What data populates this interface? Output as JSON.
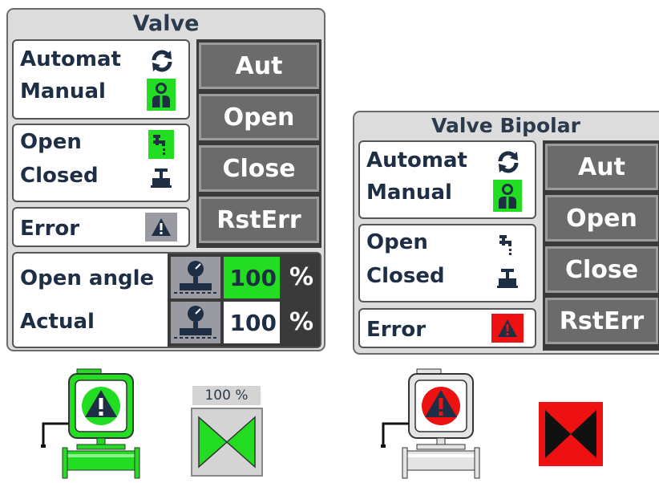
{
  "valve": {
    "title": "Valve",
    "mode_automat": "Automat",
    "mode_manual": "Manual",
    "state_open": "Open",
    "state_closed": "Closed",
    "error": "Error",
    "buttons": {
      "aut": "Aut",
      "open": "Open",
      "close": "Close",
      "rsterr": "RstErr"
    },
    "open_angle_label": "Open angle",
    "open_angle_value": "100",
    "actual_label": "Actual",
    "actual_value": "100",
    "unit": "%"
  },
  "valve_bipolar": {
    "title": "Valve Bipolar",
    "mode_automat": "Automat",
    "mode_manual": "Manual",
    "state_open": "Open",
    "state_closed": "Closed",
    "error": "Error",
    "buttons": {
      "aut": "Aut",
      "open": "Open",
      "close": "Close",
      "rsterr": "RstErr"
    }
  },
  "valve_symbol": {
    "position_label": "100 %",
    "state_color": "#22dd22"
  },
  "bipolar_symbol": {
    "state_color": "#ee1111"
  },
  "colors": {
    "active_green": "#22dd22",
    "alarm_red": "#ee1111",
    "panel_bg": "#dcdcdc",
    "button_bg": "#6b6b6b"
  }
}
